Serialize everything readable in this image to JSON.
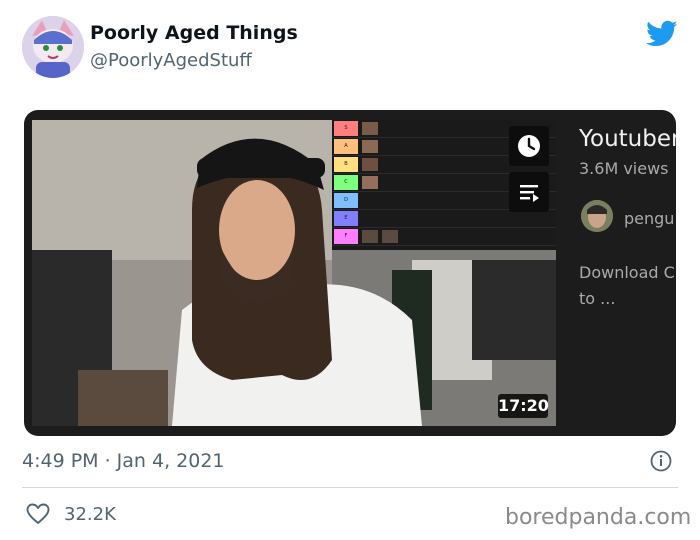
{
  "tweet": {
    "author_name": "Poorly Aged Things",
    "author_handle": "@PoorlyAgedStuff",
    "timestamp": "4:49 PM · Jan 4, 2021",
    "likes": "32.2K"
  },
  "video_card": {
    "duration": "17:20",
    "title_partial": "Youtuber",
    "views_partial": "3.6M views",
    "channel_partial": "pengu",
    "description_line1": "Download C",
    "description_line2": "to ...",
    "tier_labels": [
      "S",
      "A",
      "B",
      "C",
      "D",
      "E",
      "F"
    ],
    "tier_colors": [
      "#ff7f7f",
      "#ffbf7f",
      "#ffdf7f",
      "#7fff7f",
      "#7fbfff",
      "#7f7fff",
      "#ff7fff"
    ]
  },
  "watermark": "boredpanda.com",
  "colors": {
    "twitter_blue": "#1d9bf0",
    "card_bg": "#1c1c1c"
  },
  "icons": [
    "twitter-bird-icon",
    "clock-icon",
    "queue-icon",
    "info-icon",
    "heart-icon"
  ]
}
